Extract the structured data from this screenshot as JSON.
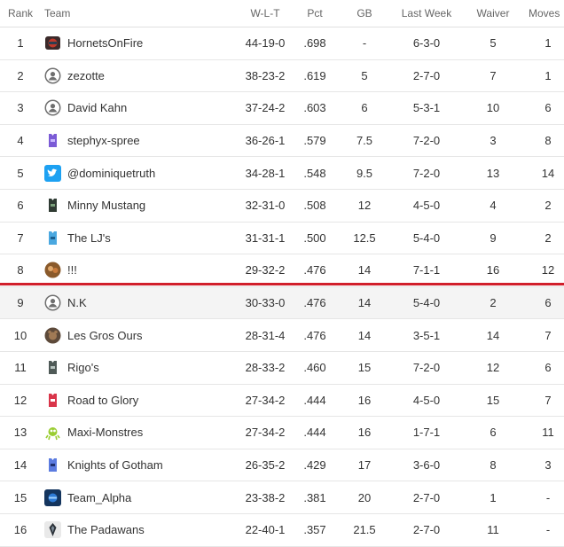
{
  "headers": {
    "rank": "Rank",
    "team": "Team",
    "wlt": "W-L-T",
    "pct": "Pct",
    "gb": "GB",
    "last_week": "Last Week",
    "waiver": "Waiver",
    "moves": "Moves"
  },
  "rows": [
    {
      "rank": "1",
      "team": "HornetsOnFire",
      "icon": "hornets-logo-icon",
      "wlt": "44-19-0",
      "pct": ".698",
      "gb": "-",
      "last_week": "6-3-0",
      "waiver": "5",
      "moves": "1"
    },
    {
      "rank": "2",
      "team": "zezotte",
      "icon": "default-avatar-icon",
      "wlt": "38-23-2",
      "pct": ".619",
      "gb": "5",
      "last_week": "2-7-0",
      "waiver": "7",
      "moves": "1"
    },
    {
      "rank": "3",
      "team": "David Kahn",
      "icon": "default-avatar-icon",
      "wlt": "37-24-2",
      "pct": ".603",
      "gb": "6",
      "last_week": "5-3-1",
      "waiver": "10",
      "moves": "6"
    },
    {
      "rank": "4",
      "team": "stephyx-spree",
      "icon": "purple-jersey-icon",
      "wlt": "36-26-1",
      "pct": ".579",
      "gb": "7.5",
      "last_week": "7-2-0",
      "waiver": "3",
      "moves": "8"
    },
    {
      "rank": "5",
      "team": "@dominiquetruth",
      "icon": "twitter-bird-icon",
      "wlt": "34-28-1",
      "pct": ".548",
      "gb": "9.5",
      "last_week": "7-2-0",
      "waiver": "13",
      "moves": "14"
    },
    {
      "rank": "6",
      "team": "Minny Mustang",
      "icon": "dark-jersey-icon",
      "wlt": "32-31-0",
      "pct": ".508",
      "gb": "12",
      "last_week": "4-5-0",
      "waiver": "4",
      "moves": "2"
    },
    {
      "rank": "7",
      "team": "The LJ's",
      "icon": "blue-jersey-icon",
      "wlt": "31-31-1",
      "pct": ".500",
      "gb": "12.5",
      "last_week": "5-4-0",
      "waiver": "9",
      "moves": "2"
    },
    {
      "rank": "8",
      "team": "!!!",
      "icon": "photo-avatar-icon",
      "wlt": "29-32-2",
      "pct": ".476",
      "gb": "14",
      "last_week": "7-1-1",
      "waiver": "16",
      "moves": "12"
    },
    {
      "rank": "9",
      "team": "N.K",
      "icon": "default-avatar-icon",
      "wlt": "30-33-0",
      "pct": ".476",
      "gb": "14",
      "last_week": "5-4-0",
      "waiver": "2",
      "moves": "6"
    },
    {
      "rank": "10",
      "team": "Les Gros Ours",
      "icon": "bear-photo-icon",
      "wlt": "28-31-4",
      "pct": ".476",
      "gb": "14",
      "last_week": "3-5-1",
      "waiver": "14",
      "moves": "7"
    },
    {
      "rank": "11",
      "team": "Rigo's",
      "icon": "gray-jersey-icon",
      "wlt": "28-33-2",
      "pct": ".460",
      "gb": "15",
      "last_week": "7-2-0",
      "waiver": "12",
      "moves": "6"
    },
    {
      "rank": "12",
      "team": "Road to Glory",
      "icon": "red-jersey-icon",
      "wlt": "27-34-2",
      "pct": ".444",
      "gb": "16",
      "last_week": "4-5-0",
      "waiver": "15",
      "moves": "7"
    },
    {
      "rank": "13",
      "team": "Maxi-Monstres",
      "icon": "monster-icon",
      "wlt": "27-34-2",
      "pct": ".444",
      "gb": "16",
      "last_week": "1-7-1",
      "waiver": "6",
      "moves": "11"
    },
    {
      "rank": "14",
      "team": "Knights of Gotham",
      "icon": "navy-jersey-icon",
      "wlt": "26-35-2",
      "pct": ".429",
      "gb": "17",
      "last_week": "3-6-0",
      "waiver": "8",
      "moves": "3"
    },
    {
      "rank": "15",
      "team": "Team_Alpha",
      "icon": "alpha-logo-icon",
      "wlt": "23-38-2",
      "pct": ".381",
      "gb": "20",
      "last_week": "2-7-0",
      "waiver": "1",
      "moves": "-"
    },
    {
      "rank": "16",
      "team": "The Padawans",
      "icon": "padawan-logo-icon",
      "wlt": "22-40-1",
      "pct": ".357",
      "gb": "21.5",
      "last_week": "2-7-0",
      "waiver": "11",
      "moves": "-"
    }
  ],
  "colors": {
    "playoff_line": "#d11f2b",
    "shaded_row": "#f4f4f4",
    "twitter_blue": "#1da1f2"
  }
}
